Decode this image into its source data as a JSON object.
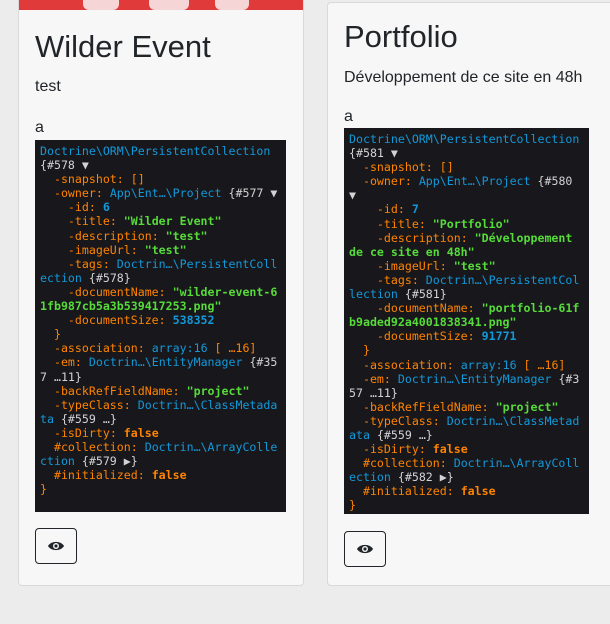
{
  "cards": [
    {
      "title": "Wilder Event",
      "description": "test",
      "tag_line": "a",
      "dump": {
        "class": "Doctrine\\ORM\\PersistentCollection",
        "ref": "{#578",
        "snapshot_key": "-snapshot",
        "snapshot_val": "[]",
        "owner_key": "-owner",
        "owner_val": "App\\Ent…\\Project",
        "owner_ref": "{#577",
        "id_key": "-id",
        "id_val": "6",
        "title_key": "-title",
        "title_val": "\"Wilder Event\"",
        "description_key": "-description",
        "description_val": "\"test\"",
        "imageUrl_key": "-imageUrl",
        "imageUrl_val": "\"test\"",
        "tags_key": "-tags",
        "tags_val": "Doctrin…\\PersistentCollection",
        "tags_ref": "{#578}",
        "documentName_key": "-documentName",
        "documentName_val": "\"wilder-event-61fb987cb5a3b539417253.png\"",
        "documentSize_key": "-documentSize",
        "documentSize_val": "538352",
        "association_key": "-association",
        "association_val": "array:16",
        "association_more": "[ …16]",
        "em_key": "-em",
        "em_val": "Doctrin…\\EntityManager",
        "em_ref": "{#357 …11}",
        "backRef_key": "-backRefFieldName",
        "backRef_val": "\"project\"",
        "typeClass_key": "-typeClass",
        "typeClass_val": "Doctrin…\\ClassMetadata",
        "typeClass_ref": "{#559 …}",
        "isDirty_key": "-isDirty",
        "isDirty_val": "false",
        "collection_key": "#collection",
        "collection_val": "Doctrin…\\ArrayCollection",
        "collection_ref": "{#579 ▶}",
        "initialized_key": "#initialized",
        "initialized_val": "false"
      }
    },
    {
      "title": "Portfolio",
      "description": "Développement de ce site en 48h",
      "tag_line": "a",
      "dump": {
        "class": "Doctrine\\ORM\\PersistentCollection",
        "ref": "{#581",
        "snapshot_key": "-snapshot",
        "snapshot_val": "[]",
        "owner_key": "-owner",
        "owner_val": "App\\Ent…\\Project",
        "owner_ref": "{#580",
        "id_key": "-id",
        "id_val": "7",
        "title_key": "-title",
        "title_val": "\"Portfolio\"",
        "description_key": "-description",
        "description_val": "\"Développement de ce site en 48h\"",
        "imageUrl_key": "-imageUrl",
        "imageUrl_val": "\"test\"",
        "tags_key": "-tags",
        "tags_val": "Doctrin…\\PersistentCollection",
        "tags_ref": "{#581}",
        "documentName_key": "-documentName",
        "documentName_val": "\"portfolio-61fb9aded92a4001838341.png\"",
        "documentSize_key": "-documentSize",
        "documentSize_val": "91771",
        "association_key": "-association",
        "association_val": "array:16",
        "association_more": "[ …16]",
        "em_key": "-em",
        "em_val": "Doctrin…\\EntityManager",
        "em_ref": "{#357 …11}",
        "backRef_key": "-backRefFieldName",
        "backRef_val": "\"project\"",
        "typeClass_key": "-typeClass",
        "typeClass_val": "Doctrin…\\ClassMetadata",
        "typeClass_ref": "{#559 …}",
        "isDirty_key": "-isDirty",
        "isDirty_val": "false",
        "collection_key": "#collection",
        "collection_val": "Doctrin…\\ArrayCollection",
        "collection_ref": "{#582 ▶}",
        "initialized_key": "#initialized",
        "initialized_val": "false"
      }
    }
  ],
  "icons": {
    "view": "eye-icon"
  },
  "colors": {
    "dump_bg": "#18171b",
    "dump_key": "#ff8400",
    "dump_string": "#56db3a",
    "dump_number": "#1299da"
  }
}
